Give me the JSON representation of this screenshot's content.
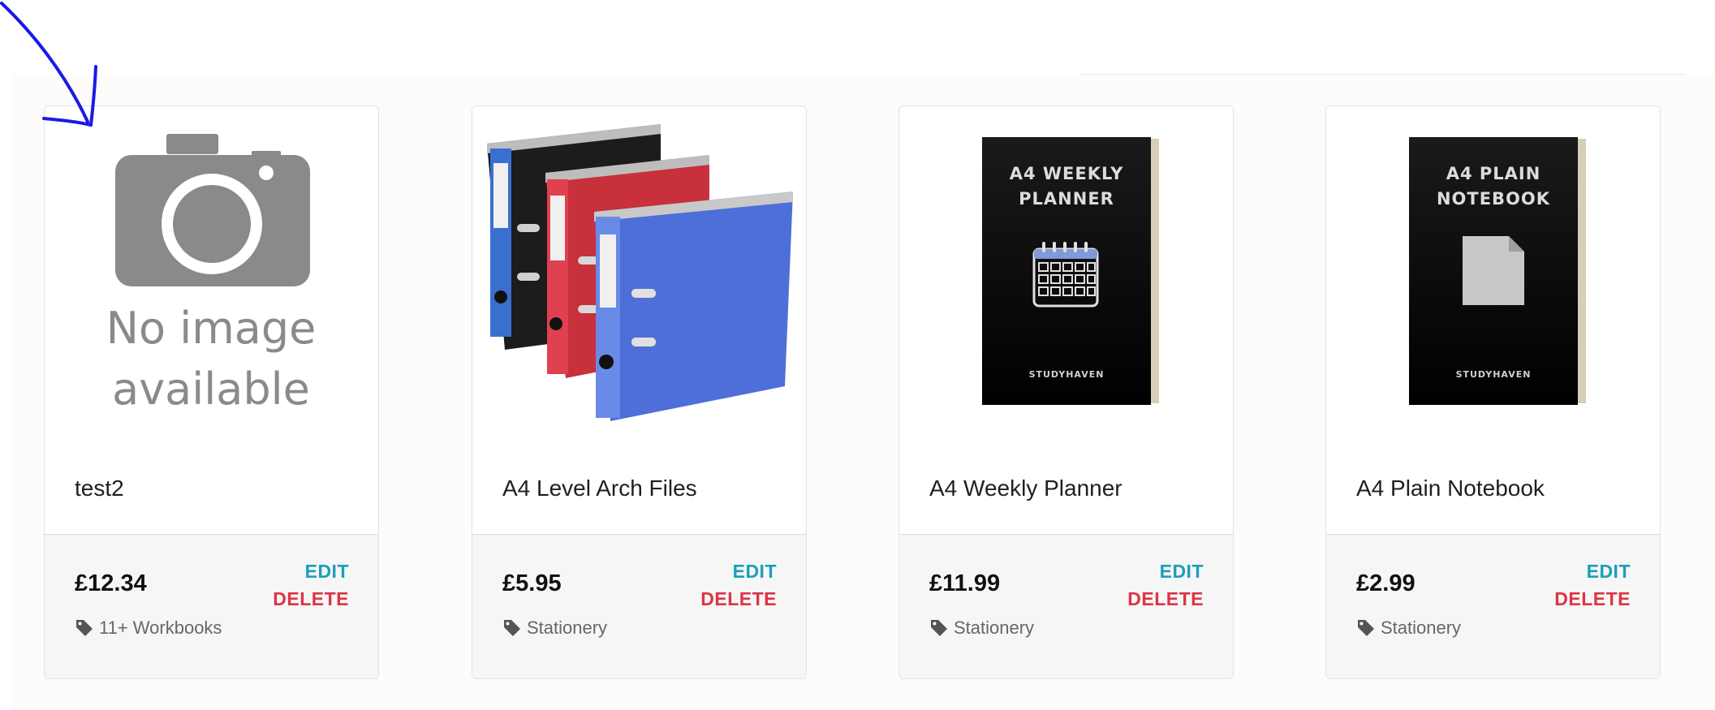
{
  "products": [
    {
      "title": "test2",
      "price": "£12.34",
      "category": "11+ Workbooks",
      "image_icon": "no-image-placeholder",
      "placeholder_text_line1": "No image",
      "placeholder_text_line2": "available"
    },
    {
      "title": "A4 Level Arch Files",
      "price": "£5.95",
      "category": "Stationery",
      "image_icon": "lever-arch-files-photo"
    },
    {
      "title": "A4 Weekly Planner",
      "price": "£11.99",
      "category": "Stationery",
      "image_icon": "weekly-planner-cover",
      "cover_title_line1": "A4 WEEKLY",
      "cover_title_line2": "PLANNER",
      "cover_brand": "STUDYHAVEN"
    },
    {
      "title": "A4 Plain Notebook",
      "price": "£2.99",
      "category": "Stationery",
      "image_icon": "plain-notebook-cover",
      "cover_title_line1": "A4 PLAIN",
      "cover_title_line2": "NOTEBOOK",
      "cover_brand": "STUDYHAVEN"
    }
  ],
  "actions": {
    "edit_label": "EDIT",
    "delete_label": "DELETE"
  },
  "colors": {
    "edit": "#1aa0b8",
    "delete": "#dc3545",
    "annotation_arrow": "#1a1ae6"
  },
  "annotation": {
    "icon": "hand-drawn-arrow-icon"
  }
}
